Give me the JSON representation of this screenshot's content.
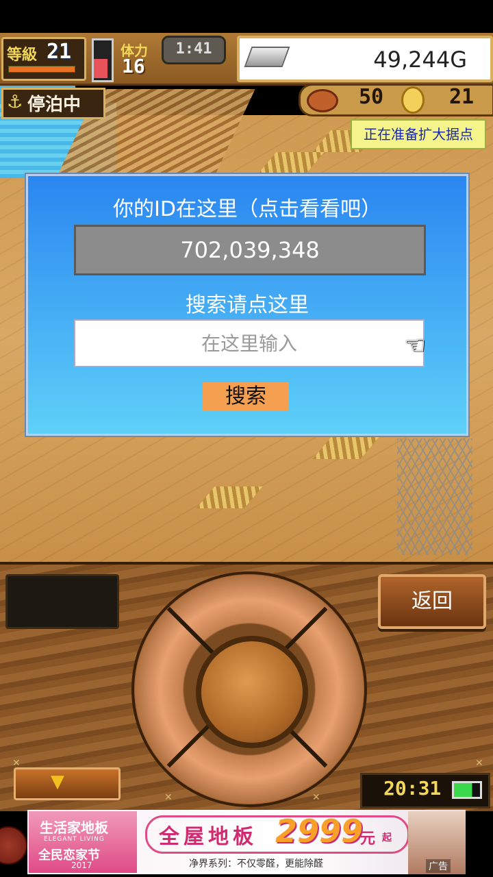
{
  "hud": {
    "level_label": "等級",
    "level_value": "21",
    "stamina_label": "体力",
    "stamina_value": "16",
    "timer": "1:41",
    "gold": "49,244G",
    "status_badge": "停泊中",
    "resource_1": "50",
    "resource_2": "21",
    "notice": "正在准备扩大据点"
  },
  "dialog": {
    "title": "你的ID在这里（点击看看吧）",
    "id_value": "702,039,348",
    "search_label": "搜索请点这里",
    "search_placeholder": "在这里输入",
    "search_button": "搜索"
  },
  "console": {
    "back_button": "返回",
    "clock": "20:31",
    "battery_level": 0.7
  },
  "ad": {
    "brand": "生活家地板",
    "brand_sub": "ELEGANT LIVING",
    "event": "全民恋家节",
    "year": "2017",
    "headline": "全屋地板",
    "price": "2999",
    "unit": "元",
    "unit_suffix": "起",
    "footer": "净界系列：不仅零醛，更能除醛",
    "tag": "广告"
  },
  "colors": {
    "dialog_top": "#2a86f0",
    "dialog_bottom": "#5ed0f8",
    "search_button": "#f4a050",
    "notice_bg": "#f4f48a",
    "ad_accent": "#e04a86"
  }
}
